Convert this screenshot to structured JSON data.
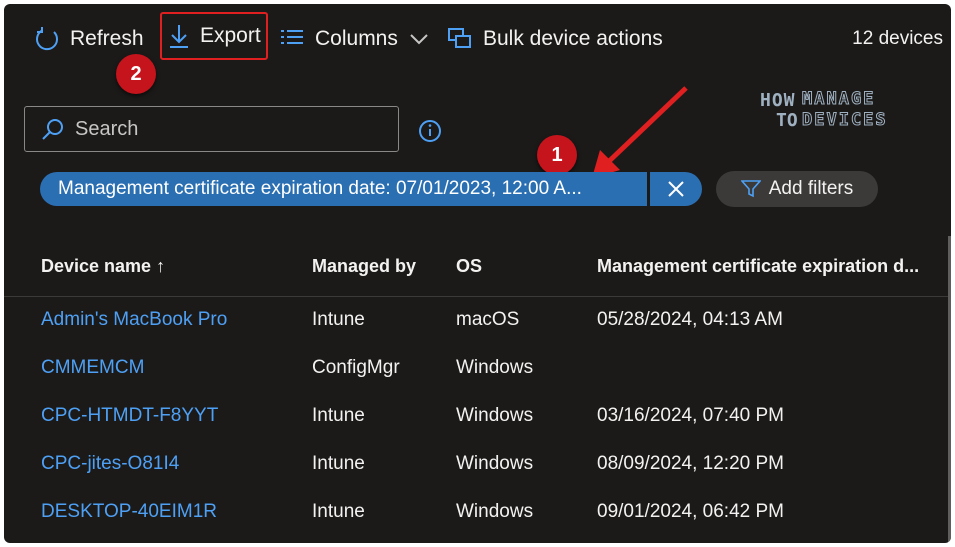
{
  "toolbar": {
    "refresh_label": "Refresh",
    "export_label": "Export",
    "columns_label": "Columns",
    "bulk_label": "Bulk device actions",
    "device_count": "12 devices"
  },
  "annotations": {
    "badge_1": "1",
    "badge_2": "2",
    "highlight_color": "#e02020"
  },
  "search": {
    "placeholder": "Search"
  },
  "logo": {
    "how": "HOW",
    "to": "TO",
    "manage": "MANAGE",
    "devices": "DEVICES"
  },
  "filter": {
    "chip_label": "Management certificate expiration date: 07/01/2023, 12:00 A...",
    "add_filters_label": "Add filters"
  },
  "table": {
    "headers": [
      "Device name ↑",
      "Managed by",
      "OS",
      "Management certificate expiration d..."
    ],
    "rows": [
      [
        "Admin's MacBook Pro",
        "Intune",
        "macOS",
        "05/28/2024, 04:13 AM"
      ],
      [
        "CMMEMCM",
        "ConfigMgr",
        "Windows",
        ""
      ],
      [
        "CPC-HTMDT-F8YYT",
        "Intune",
        "Windows",
        "03/16/2024, 07:40 PM"
      ],
      [
        "CPC-jites-O81I4",
        "Intune",
        "Windows",
        "08/09/2024, 12:20 PM"
      ],
      [
        "DESKTOP-40EIM1R",
        "Intune",
        "Windows",
        "09/01/2024, 06:42 PM"
      ]
    ]
  },
  "colors": {
    "background": "#1b1a19",
    "accent": "#2b6fb3",
    "link": "#4ea0f5",
    "badge": "#c5141c"
  }
}
